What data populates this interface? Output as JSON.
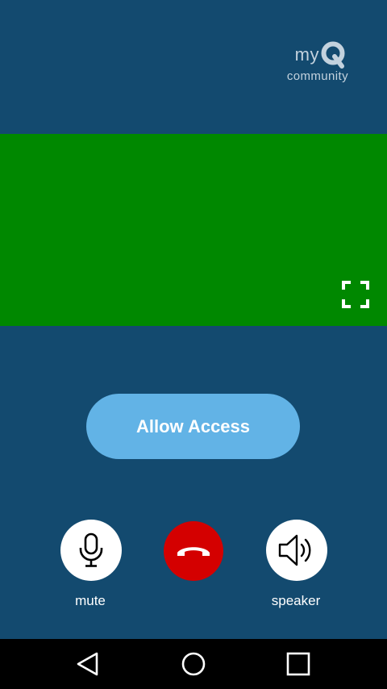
{
  "logo": {
    "brand_prefix": "my",
    "brand_letter": "Q",
    "subtitle": "community"
  },
  "video": {
    "background_color": "#008800",
    "fullscreen_icon": "fullscreen-icon"
  },
  "actions": {
    "allow_access_label": "Allow Access"
  },
  "controls": {
    "mute_label": "mute",
    "mute_icon": "microphone-icon",
    "hangup_icon": "phone-hangup-icon",
    "hangup_color": "#d40000",
    "speaker_label": "speaker",
    "speaker_icon": "speaker-icon"
  },
  "navbar": {
    "back_icon": "back-triangle-icon",
    "home_icon": "home-circle-icon",
    "recent_icon": "recent-apps-square-icon"
  },
  "colors": {
    "background": "#134a6f",
    "accent_button": "#62b3e6"
  }
}
